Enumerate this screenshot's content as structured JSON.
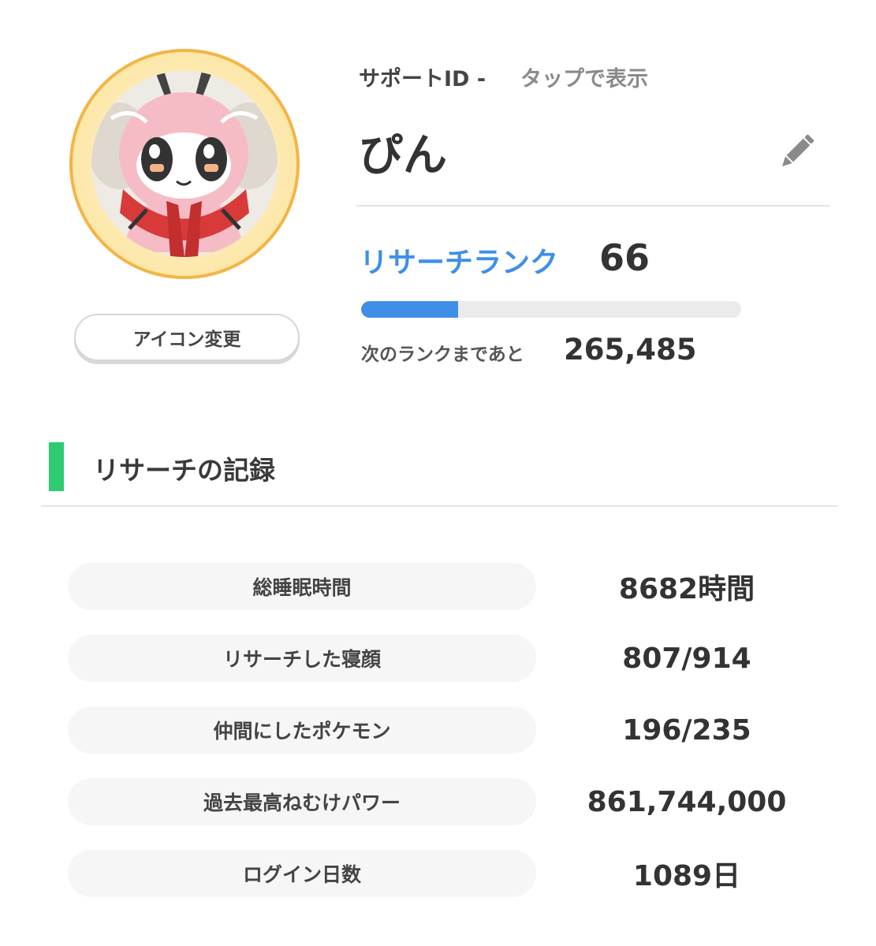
{
  "profile": {
    "support_id_label": "サポートID -",
    "support_id_action": "タップで表示",
    "player_name": "ぴん",
    "icon_change_label": "アイコン変更"
  },
  "rank": {
    "label": "リサーチランク",
    "value": "66",
    "progress_fraction": 0.255,
    "next_label": "次のランクまであと",
    "next_value": "265,485"
  },
  "records": {
    "title": "リサーチの記録",
    "rows": [
      {
        "label": "総睡眠時間",
        "value": "8682時間"
      },
      {
        "label": "リサーチした寝顔",
        "value": "807/914"
      },
      {
        "label": "仲間にしたポケモン",
        "value": "196/235"
      },
      {
        "label": "過去最高ねむけパワー",
        "value": "861,744,000"
      },
      {
        "label": "ログイン日数",
        "value": "1089日"
      }
    ]
  },
  "icons": {
    "edit": "pencil-icon",
    "avatar": "pokemon-avatar"
  },
  "colors": {
    "accent_blue": "#3f8fe8",
    "section_green": "#2ecc71",
    "avatar_ring": "#f3b548"
  }
}
